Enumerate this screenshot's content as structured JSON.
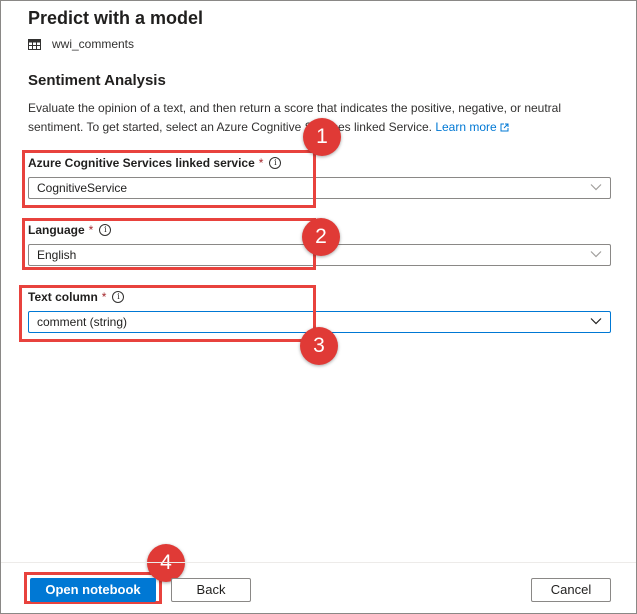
{
  "panel": {
    "title": "Predict with a model",
    "dataset": "wwi_comments"
  },
  "section": {
    "title": "Sentiment Analysis",
    "description": "Evaluate the opinion of a text, and then return a score that indicates the positive, negative, or neutral sentiment. To get started, select an Azure Cognitive Services linked Service.",
    "learn_more": "Learn more"
  },
  "fields": {
    "linked_service": {
      "label": "Azure Cognitive Services linked service",
      "required_mark": "*",
      "value": "CognitiveService"
    },
    "language": {
      "label": "Language",
      "required_mark": "*",
      "value": "English"
    },
    "text_column": {
      "label": "Text column",
      "required_mark": "*",
      "value": "comment (string)"
    }
  },
  "info_glyph": "i",
  "callouts": [
    "1",
    "2",
    "3",
    "4"
  ],
  "buttons": {
    "open_notebook": "Open notebook",
    "back": "Back",
    "cancel": "Cancel"
  },
  "colors": {
    "accent": "#0078d4",
    "callout": "#e8423d",
    "required": "#a4262c"
  },
  "icons": {
    "dataset": "table-icon",
    "external": "external-link-icon",
    "info": "info-icon",
    "dropdown": "chevron-down-icon"
  }
}
